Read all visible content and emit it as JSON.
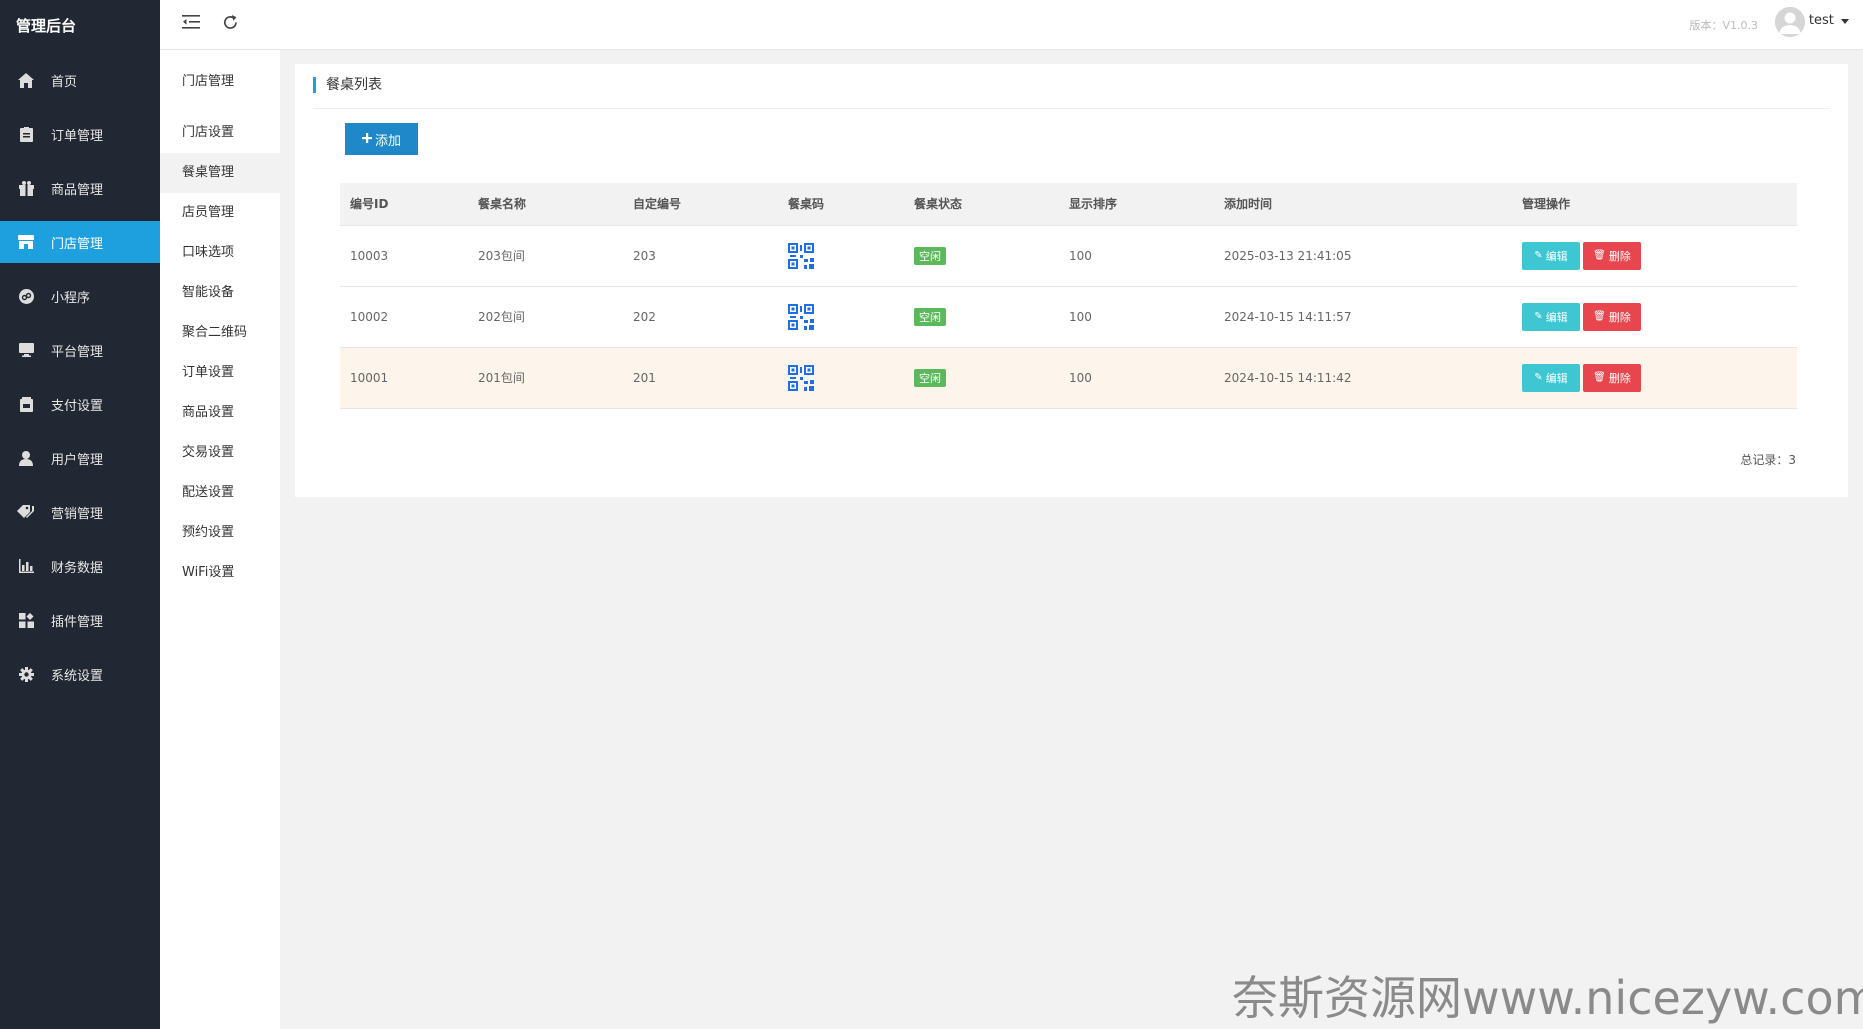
{
  "brand": "管理后台",
  "nav": [
    {
      "label": "首页",
      "icon": "home-icon"
    },
    {
      "label": "订单管理",
      "icon": "clipboard-icon"
    },
    {
      "label": "商品管理",
      "icon": "gift-icon"
    },
    {
      "label": "门店管理",
      "icon": "store-icon",
      "active": true
    },
    {
      "label": "小程序",
      "icon": "miniprogram-icon"
    },
    {
      "label": "平台管理",
      "icon": "monitor-icon"
    },
    {
      "label": "支付设置",
      "icon": "wallet-icon"
    },
    {
      "label": "用户管理",
      "icon": "user-icon"
    },
    {
      "label": "营销管理",
      "icon": "tags-icon"
    },
    {
      "label": "财务数据",
      "icon": "bar-chart-icon"
    },
    {
      "label": "插件管理",
      "icon": "puzzle-icon"
    },
    {
      "label": "系统设置",
      "icon": "gear-icon"
    }
  ],
  "subnav": {
    "title": "门店管理",
    "items": [
      {
        "label": "门店设置"
      },
      {
        "label": "餐桌管理",
        "active": true
      },
      {
        "label": "店员管理"
      },
      {
        "label": "口味选项"
      },
      {
        "label": "智能设备"
      },
      {
        "label": "聚合二维码"
      },
      {
        "label": "订单设置"
      },
      {
        "label": "商品设置"
      },
      {
        "label": "交易设置"
      },
      {
        "label": "配送设置"
      },
      {
        "label": "预约设置"
      },
      {
        "label": "WiFi设置"
      }
    ]
  },
  "header": {
    "version": "版本：V1.0.3",
    "username": "test"
  },
  "card": {
    "title": "餐桌列表",
    "add_label": "添加"
  },
  "table": {
    "columns": [
      "编号ID",
      "餐桌名称",
      "自定编号",
      "餐桌码",
      "餐桌状态",
      "显示排序",
      "添加时间",
      "管理操作"
    ],
    "rows": [
      {
        "id": "10003",
        "name": "203包间",
        "code": "203",
        "status": "空闲",
        "sort": "100",
        "time": "2025-03-13 21:41:05"
      },
      {
        "id": "10002",
        "name": "202包间",
        "code": "202",
        "status": "空闲",
        "sort": "100",
        "time": "2024-10-15 14:11:57"
      },
      {
        "id": "10001",
        "name": "201包间",
        "code": "201",
        "status": "空闲",
        "sort": "100",
        "time": "2024-10-15 14:11:42"
      }
    ],
    "edit_label": "编辑",
    "delete_label": "删除"
  },
  "total": "总记录：3",
  "watermark": "奈斯资源网www.nicezyw.com",
  "colors": {
    "sidebar_bg": "#222833",
    "accent": "#1e9fde",
    "status_green": "#5cb85c",
    "edit_cyan": "#3ec6d3",
    "delete_red": "#e8464f"
  }
}
